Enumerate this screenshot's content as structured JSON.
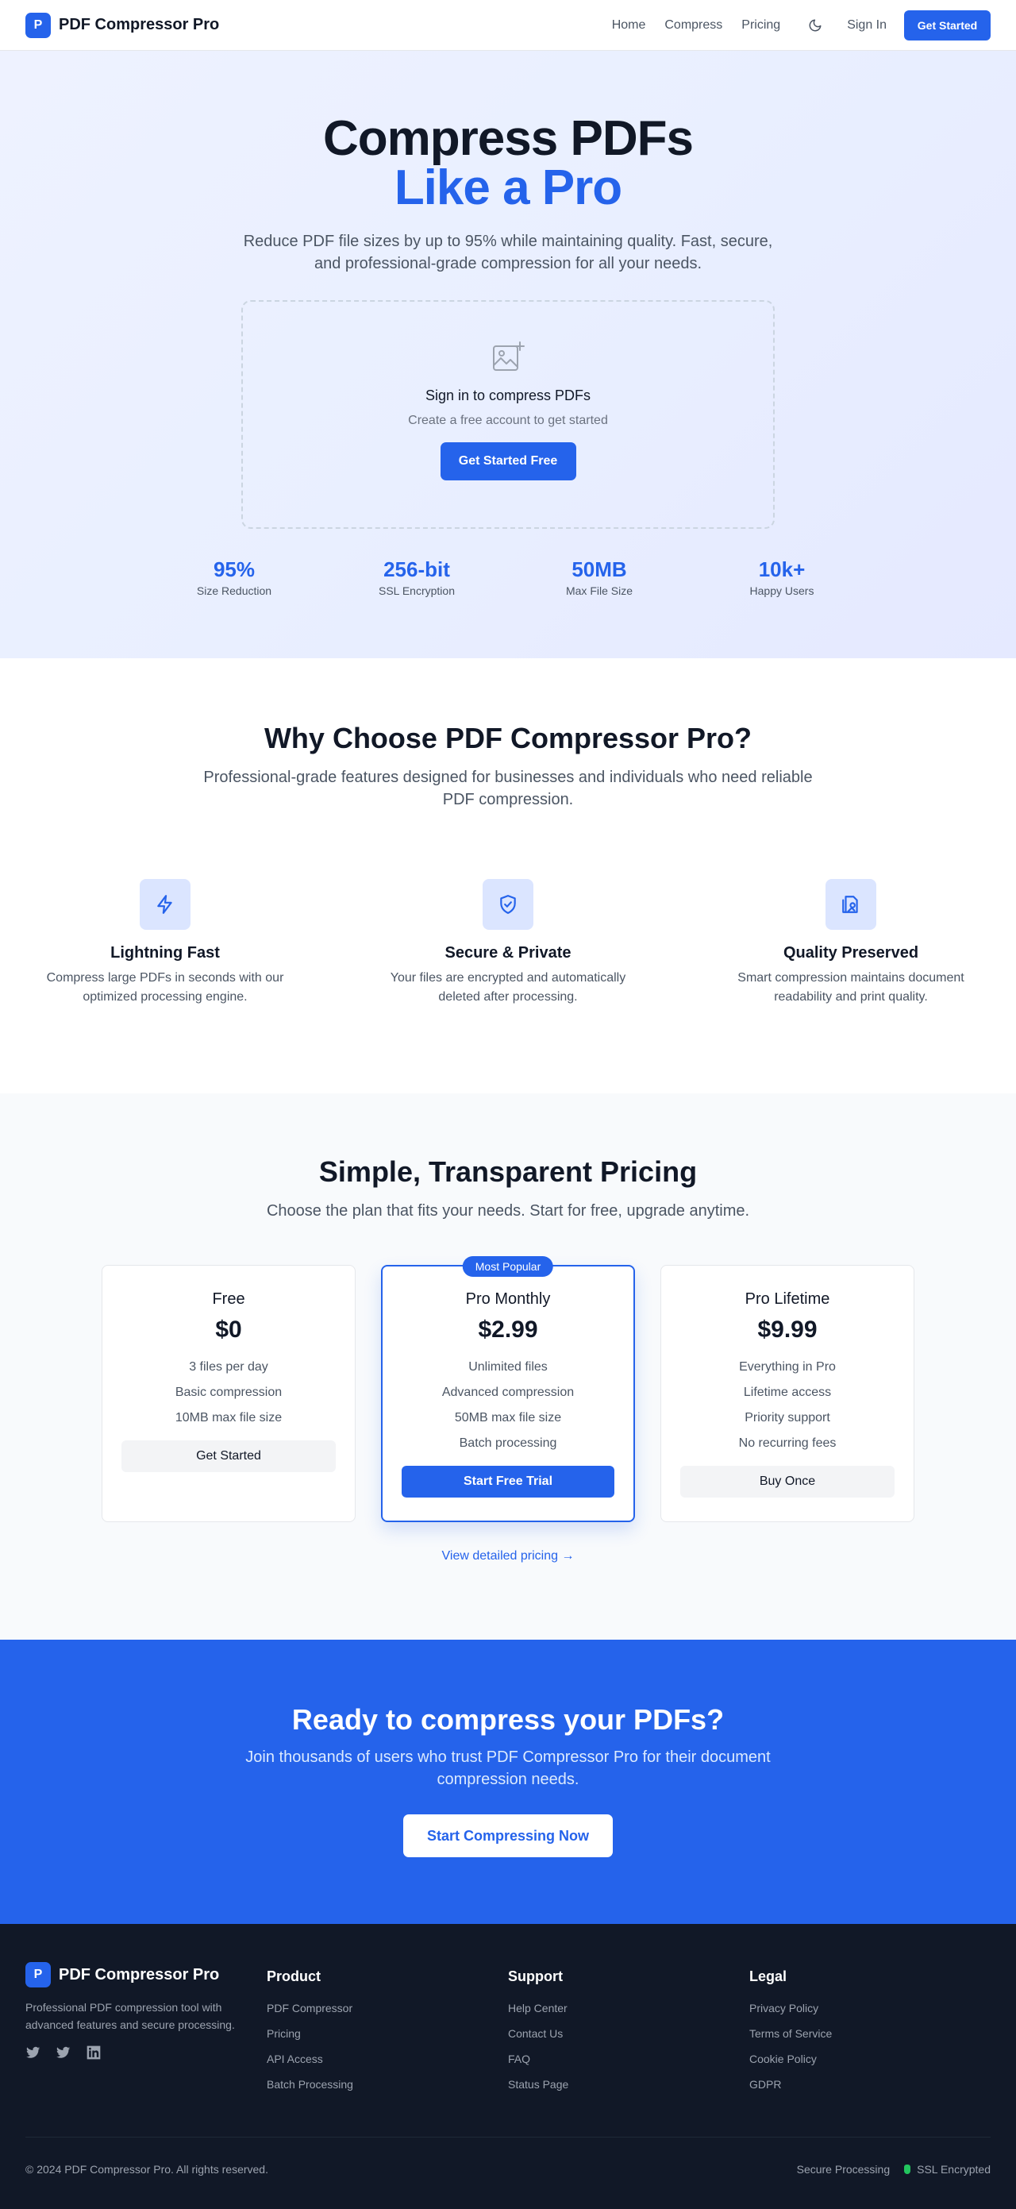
{
  "nav": {
    "brand_letter": "P",
    "brand_name": "PDF Compressor Pro",
    "links": [
      "Home",
      "Compress",
      "Pricing"
    ],
    "signin": "Sign In",
    "cta": "Get Started",
    "theme_icon": "moon-icon"
  },
  "hero": {
    "title_line1": "Compress PDFs",
    "title_line2": "Like a Pro",
    "subtitle": "Reduce PDF file sizes by up to 95% while maintaining quality. Fast, secure, and professional-grade compression for all your needs.",
    "dropzone": {
      "icon": "image-add-icon",
      "title": "Sign in to compress PDFs",
      "subtitle": "Create a free account to get started",
      "button": "Get Started Free"
    },
    "stats": [
      {
        "value": "95%",
        "label": "Size Reduction"
      },
      {
        "value": "256-bit",
        "label": "SSL Encryption"
      },
      {
        "value": "50MB",
        "label": "Max File Size"
      },
      {
        "value": "10k+",
        "label": "Happy Users"
      }
    ]
  },
  "features": {
    "title": "Why Choose PDF Compressor Pro?",
    "subtitle": "Professional-grade features designed for businesses and individuals who need reliable PDF compression.",
    "items": [
      {
        "icon": "lightning-icon",
        "title": "Lightning Fast",
        "desc": "Compress large PDFs in seconds with our optimized processing engine."
      },
      {
        "icon": "shield-check-icon",
        "title": "Secure & Private",
        "desc": "Your files are encrypted and automatically deleted after processing."
      },
      {
        "icon": "document-image-icon",
        "title": "Quality Preserved",
        "desc": "Smart compression maintains document readability and print quality."
      }
    ]
  },
  "pricing": {
    "title": "Simple, Transparent Pricing",
    "subtitle": "Choose the plan that fits your needs. Start for free, upgrade anytime.",
    "plans": [
      {
        "name": "Free",
        "price": "$0",
        "features": [
          "3 files per day",
          "Basic compression",
          "10MB max file size"
        ],
        "button": "Get Started"
      },
      {
        "name": "Pro Monthly",
        "price": "$2.99",
        "badge": "Most Popular",
        "features": [
          "Unlimited files",
          "Advanced compression",
          "50MB max file size",
          "Batch processing"
        ],
        "button": "Start Free Trial"
      },
      {
        "name": "Pro Lifetime",
        "price": "$9.99",
        "features": [
          "Everything in Pro",
          "Lifetime access",
          "Priority support",
          "No recurring fees"
        ],
        "button": "Buy Once"
      }
    ],
    "view_link": "View detailed pricing →"
  },
  "cta": {
    "title": "Ready to compress your PDFs?",
    "subtitle": "Join thousands of users who trust PDF Compressor Pro for their document compression needs.",
    "button": "Start Compressing Now"
  },
  "footer": {
    "brand_letter": "P",
    "brand_name": "PDF Compressor Pro",
    "desc": "Professional PDF compression tool with advanced features and secure processing.",
    "socials": [
      "twitter-icon",
      "twitter-icon",
      "linkedin-icon"
    ],
    "columns": [
      {
        "title": "Product",
        "links": [
          "PDF Compressor",
          "Pricing",
          "API Access",
          "Batch Processing"
        ]
      },
      {
        "title": "Support",
        "links": [
          "Help Center",
          "Contact Us",
          "FAQ",
          "Status Page"
        ]
      },
      {
        "title": "Legal",
        "links": [
          "Privacy Policy",
          "Terms of Service",
          "Cookie Policy",
          "GDPR"
        ]
      }
    ],
    "copyright": "© 2024 PDF Compressor Pro. All rights reserved.",
    "secure": "Secure Processing",
    "ssl": "SSL Encrypted"
  },
  "colors": {
    "primary": "#2563eb",
    "dark": "#111827",
    "ssl_green": "#22c55e"
  }
}
